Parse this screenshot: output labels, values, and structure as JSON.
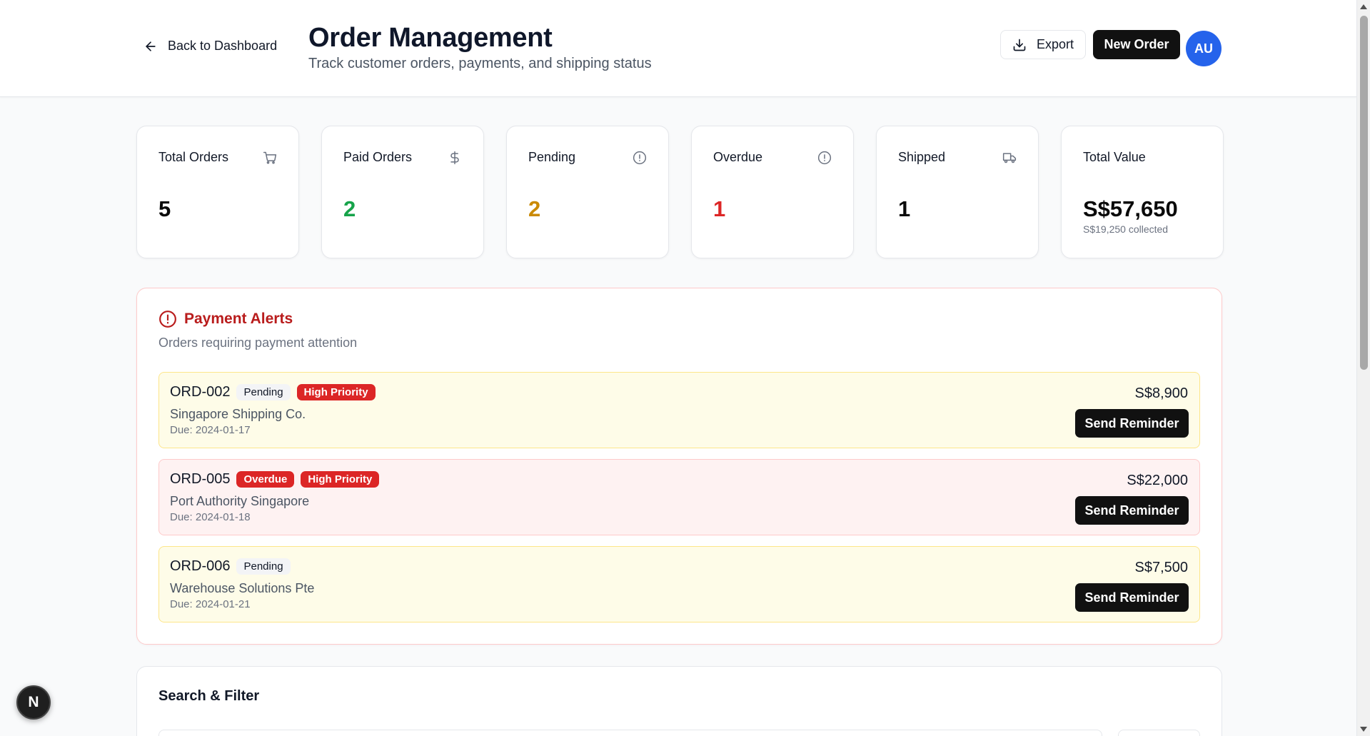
{
  "header": {
    "back_label": "Back to Dashboard",
    "title": "Order Management",
    "subtitle": "Track customer orders, payments, and shipping status",
    "export_label": "Export",
    "new_order_label": "New Order",
    "avatar_initials": "AU"
  },
  "stats": [
    {
      "label": "Total Orders",
      "value": "5",
      "icon": "cart-icon",
      "color": "#0a0a0a"
    },
    {
      "label": "Paid Orders",
      "value": "2",
      "icon": "dollar-icon",
      "color": "#16a34a"
    },
    {
      "label": "Pending",
      "value": "2",
      "icon": "alert-circle-icon",
      "color": "#ca8a04"
    },
    {
      "label": "Overdue",
      "value": "1",
      "icon": "alert-circle-icon",
      "color": "#dc2626"
    },
    {
      "label": "Shipped",
      "value": "1",
      "icon": "truck-icon",
      "color": "#0a0a0a"
    },
    {
      "label": "Total Value",
      "value": "S$57,650",
      "sub": "S$19,250 collected",
      "color": "#0a0a0a"
    }
  ],
  "alerts": {
    "title": "Payment Alerts",
    "description": "Orders requiring payment attention",
    "items": [
      {
        "id": "ORD-002",
        "status": "Pending",
        "priority": "High Priority",
        "customer": "Singapore Shipping Co.",
        "due": "Due: 2024-01-17",
        "amount": "S$8,900",
        "action": "Send Reminder"
      },
      {
        "id": "ORD-005",
        "status": "Overdue",
        "priority": "High Priority",
        "customer": "Port Authority Singapore",
        "due": "Due: 2024-01-18",
        "amount": "S$22,000",
        "action": "Send Reminder"
      },
      {
        "id": "ORD-006",
        "status": "Pending",
        "customer": "Warehouse Solutions Pte",
        "due": "Due: 2024-01-21",
        "amount": "S$7,500",
        "action": "Send Reminder"
      }
    ]
  },
  "search": {
    "title": "Search & Filter"
  },
  "dev_badge": "N",
  "colors": {
    "accent": "#111111",
    "avatar": "#2563eb",
    "alert_red": "#b91c1c",
    "badge_red": "#dc2626"
  }
}
